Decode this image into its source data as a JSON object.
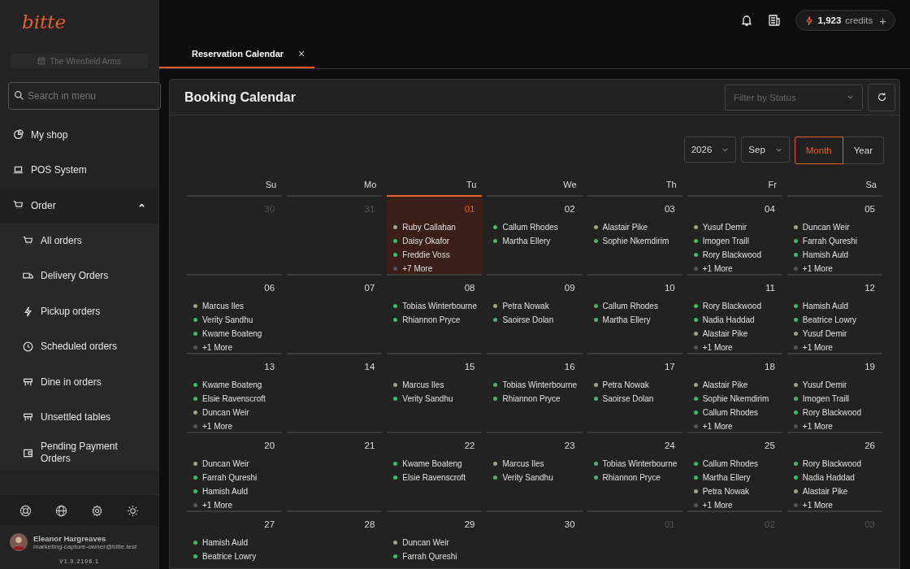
{
  "sidebar": {
    "logo": "bitte",
    "store": "The Wrenfield Arms",
    "search": {
      "placeholder": "Search in menu"
    },
    "items": [
      {
        "label": "My shop"
      },
      {
        "label": "POS System"
      },
      {
        "label": "Order",
        "expanded": true,
        "children": [
          {
            "label": "All orders"
          },
          {
            "label": "Delivery Orders"
          },
          {
            "label": "Pickup orders"
          },
          {
            "label": "Scheduled orders"
          },
          {
            "label": "Dine in orders"
          },
          {
            "label": "Unsettled tables"
          },
          {
            "label": "Pending Payment Orders"
          }
        ]
      }
    ],
    "user": {
      "name": "Eleanor Hargreaves",
      "email": "marketing-capture-owner@bitte.test"
    },
    "version": "V1.0.2106.1"
  },
  "topbar": {
    "credits": {
      "amount": "1,923",
      "label": "credits",
      "add": "+"
    }
  },
  "tabs": [
    {
      "label": "Reservation Calendar",
      "selected": true,
      "close": "×"
    }
  ],
  "panel": {
    "title": "Booking Calendar",
    "filter": {
      "placeholder": "Filter by Status"
    },
    "year": "2026",
    "month": "Sep",
    "views": [
      {
        "label": "Month",
        "selected": true
      },
      {
        "label": "Year",
        "selected": false
      }
    ],
    "weekdays": [
      {
        "label": "Su",
        "selected": false
      },
      {
        "label": "Mo",
        "selected": false
      },
      {
        "label": "Tu",
        "selected": true
      },
      {
        "label": "We",
        "selected": false
      },
      {
        "label": "Th",
        "selected": false
      },
      {
        "label": "Fr",
        "selected": false
      },
      {
        "label": "Sa",
        "selected": false
      }
    ],
    "weeks": [
      [
        {
          "date": "30",
          "outside": true,
          "today": false
        },
        {
          "date": "31",
          "outside": true,
          "today": false
        },
        {
          "date": "01",
          "outside": false,
          "today": true,
          "events": [
            {
              "name": "Ruby Callahan",
              "color": "#a3a086"
            },
            {
              "name": "Daisy Okafor",
              "color": "#3dbd6b"
            },
            {
              "name": "Freddie Voss",
              "color": "#3dbd6b"
            }
          ],
          "more": "+7 More"
        },
        {
          "date": "02",
          "outside": false,
          "today": false,
          "events": [
            {
              "name": "Callum Rhodes",
              "color": "#3dbd6b"
            },
            {
              "name": "Martha Ellery",
              "color": "#3dbd6b"
            }
          ]
        },
        {
          "date": "03",
          "outside": false,
          "today": false,
          "events": [
            {
              "name": "Alastair Pike",
              "color": "#a3a086"
            },
            {
              "name": "Sophie Nkemdirim",
              "color": "#3dbd6b"
            }
          ]
        },
        {
          "date": "04",
          "outside": false,
          "today": false,
          "events": [
            {
              "name": "Yusuf Demir",
              "color": "#a3a086"
            },
            {
              "name": "Imogen Traill",
              "color": "#3dbd6b"
            },
            {
              "name": "Rory Blackwood",
              "color": "#3dbd6b"
            }
          ],
          "more": "+1 More"
        },
        {
          "date": "05",
          "outside": false,
          "today": false,
          "events": [
            {
              "name": "Duncan Weir",
              "color": "#a3a086"
            },
            {
              "name": "Farrah Qureshi",
              "color": "#3dbd6b"
            },
            {
              "name": "Hamish Auld",
              "color": "#3dbd6b"
            }
          ],
          "more": "+1 More"
        }
      ],
      [
        {
          "date": "06",
          "outside": false,
          "today": false,
          "events": [
            {
              "name": "Marcus Iles",
              "color": "#a3a086"
            },
            {
              "name": "Verity Sandhu",
              "color": "#3dbd6b"
            },
            {
              "name": "Kwame Boateng",
              "color": "#3dbd6b"
            }
          ],
          "more": "+1 More"
        },
        {
          "date": "07",
          "outside": false,
          "today": false
        },
        {
          "date": "08",
          "outside": false,
          "today": false,
          "events": [
            {
              "name": "Tobias Winterbourne",
              "color": "#3dbd6b"
            },
            {
              "name": "Rhiannon Pryce",
              "color": "#3dbd6b"
            }
          ]
        },
        {
          "date": "09",
          "outside": false,
          "today": false,
          "events": [
            {
              "name": "Petra Nowak",
              "color": "#a3a086"
            },
            {
              "name": "Saoirse Dolan",
              "color": "#3dbd6b"
            }
          ]
        },
        {
          "date": "10",
          "outside": false,
          "today": false,
          "events": [
            {
              "name": "Callum Rhodes",
              "color": "#3dbd6b"
            },
            {
              "name": "Martha Ellery",
              "color": "#3dbd6b"
            }
          ]
        },
        {
          "date": "11",
          "outside": false,
          "today": false,
          "events": [
            {
              "name": "Rory Blackwood",
              "color": "#3dbd6b"
            },
            {
              "name": "Nadia Haddad",
              "color": "#3dbd6b"
            },
            {
              "name": "Alastair Pike",
              "color": "#a3a086"
            }
          ],
          "more": "+1 More"
        },
        {
          "date": "12",
          "outside": false,
          "today": false,
          "events": [
            {
              "name": "Hamish Auld",
              "color": "#3dbd6b"
            },
            {
              "name": "Beatrice Lowry",
              "color": "#3dbd6b"
            },
            {
              "name": "Yusuf Demir",
              "color": "#a3a086"
            }
          ],
          "more": "+1 More"
        }
      ],
      [
        {
          "date": "13",
          "outside": false,
          "today": false,
          "events": [
            {
              "name": "Kwame Boateng",
              "color": "#3dbd6b"
            },
            {
              "name": "Elsie Ravenscroft",
              "color": "#3dbd6b"
            },
            {
              "name": "Duncan Weir",
              "color": "#a3a086"
            }
          ],
          "more": "+1 More"
        },
        {
          "date": "14",
          "outside": false,
          "today": false
        },
        {
          "date": "15",
          "outside": false,
          "today": false,
          "events": [
            {
              "name": "Marcus Iles",
              "color": "#a3a086"
            },
            {
              "name": "Verity Sandhu",
              "color": "#3dbd6b"
            }
          ]
        },
        {
          "date": "16",
          "outside": false,
          "today": false,
          "events": [
            {
              "name": "Tobias Winterbourne",
              "color": "#3dbd6b"
            },
            {
              "name": "Rhiannon Pryce",
              "color": "#3dbd6b"
            }
          ]
        },
        {
          "date": "17",
          "outside": false,
          "today": false,
          "events": [
            {
              "name": "Petra Nowak",
              "color": "#a3a086"
            },
            {
              "name": "Saoirse Dolan",
              "color": "#3dbd6b"
            }
          ]
        },
        {
          "date": "18",
          "outside": false,
          "today": false,
          "events": [
            {
              "name": "Alastair Pike",
              "color": "#a3a086"
            },
            {
              "name": "Sophie Nkemdirim",
              "color": "#3dbd6b"
            },
            {
              "name": "Callum Rhodes",
              "color": "#3dbd6b"
            }
          ],
          "more": "+1 More"
        },
        {
          "date": "19",
          "outside": false,
          "today": false,
          "events": [
            {
              "name": "Yusuf Demir",
              "color": "#a3a086"
            },
            {
              "name": "Imogen Traill",
              "color": "#3dbd6b"
            },
            {
              "name": "Rory Blackwood",
              "color": "#3dbd6b"
            }
          ],
          "more": "+1 More"
        }
      ],
      [
        {
          "date": "20",
          "outside": false,
          "today": false,
          "events": [
            {
              "name": "Duncan Weir",
              "color": "#a3a086"
            },
            {
              "name": "Farrah Qureshi",
              "color": "#3dbd6b"
            },
            {
              "name": "Hamish Auld",
              "color": "#3dbd6b"
            }
          ],
          "more": "+1 More"
        },
        {
          "date": "21",
          "outside": false,
          "today": false
        },
        {
          "date": "22",
          "outside": false,
          "today": false,
          "events": [
            {
              "name": "Kwame Boateng",
              "color": "#3dbd6b"
            },
            {
              "name": "Elsie Ravenscroft",
              "color": "#3dbd6b"
            }
          ]
        },
        {
          "date": "23",
          "outside": false,
          "today": false,
          "events": [
            {
              "name": "Marcus Iles",
              "color": "#a3a086"
            },
            {
              "name": "Verity Sandhu",
              "color": "#3dbd6b"
            }
          ]
        },
        {
          "date": "24",
          "outside": false,
          "today": false,
          "events": [
            {
              "name": "Tobias Winterbourne",
              "color": "#3dbd6b"
            },
            {
              "name": "Rhiannon Pryce",
              "color": "#3dbd6b"
            }
          ]
        },
        {
          "date": "25",
          "outside": false,
          "today": false,
          "events": [
            {
              "name": "Callum Rhodes",
              "color": "#3dbd6b"
            },
            {
              "name": "Martha Ellery",
              "color": "#3dbd6b"
            },
            {
              "name": "Petra Nowak",
              "color": "#a3a086"
            }
          ],
          "more": "+1 More"
        },
        {
          "date": "26",
          "outside": false,
          "today": false,
          "events": [
            {
              "name": "Rory Blackwood",
              "color": "#3dbd6b"
            },
            {
              "name": "Nadia Haddad",
              "color": "#3dbd6b"
            },
            {
              "name": "Alastair Pike",
              "color": "#a3a086"
            }
          ],
          "more": "+1 More"
        }
      ],
      [
        {
          "date": "27",
          "outside": false,
          "today": false,
          "events": [
            {
              "name": "Hamish Auld",
              "color": "#3dbd6b"
            },
            {
              "name": "Beatrice Lowry",
              "color": "#3dbd6b"
            }
          ]
        },
        {
          "date": "28",
          "outside": false,
          "today": false
        },
        {
          "date": "29",
          "outside": false,
          "today": false,
          "events": [
            {
              "name": "Duncan Weir",
              "color": "#a3a086"
            },
            {
              "name": "Farrah Qureshi",
              "color": "#3dbd6b"
            }
          ]
        },
        {
          "date": "30",
          "outside": false,
          "today": false
        },
        {
          "date": "01",
          "outside": true,
          "today": false
        },
        {
          "date": "02",
          "outside": true,
          "today": false
        },
        {
          "date": "03",
          "outside": true,
          "today": false
        }
      ]
    ]
  }
}
